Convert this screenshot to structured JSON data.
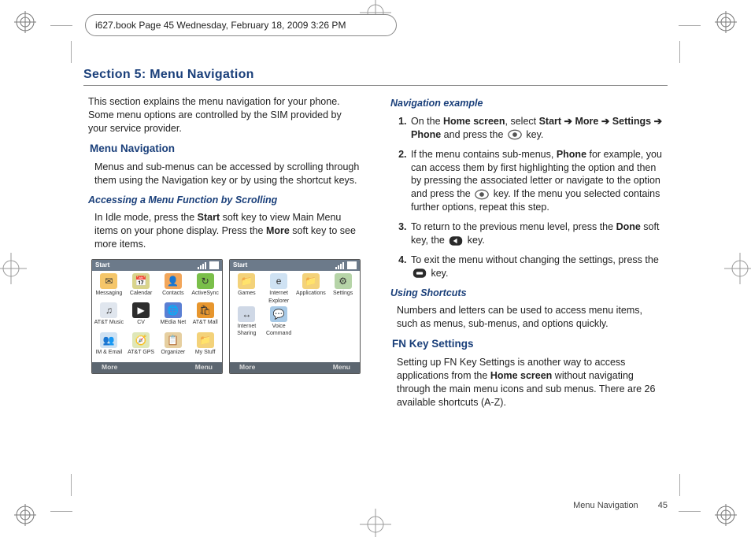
{
  "header_text": "i627.book  Page 45  Wednesday, February 18, 2009  3:26 PM",
  "section_title": "Section 5: Menu Navigation",
  "leftcol": {
    "intro": "This section explains the menu navigation for your phone. Some menu options are controlled by the SIM provided by your service provider.",
    "h2_menu_nav": "Menu Navigation",
    "menu_nav_p": "Menus and sub-menus can be accessed by scrolling through them using the Navigation key or by using the shortcut keys.",
    "h3_accessing": "Accessing a Menu Function by Scrolling",
    "accessing_p_pre": "In Idle mode, press the ",
    "accessing_b_start": "Start",
    "accessing_p_mid": " soft key to view Main Menu items on your phone display. Press the ",
    "accessing_b_more": "More",
    "accessing_p_end": " soft key to see more items."
  },
  "rightcol": {
    "h3_navex": "Navigation example",
    "step1_pre": "On the ",
    "step1_b_home": "Home screen",
    "step1_mid": ", select ",
    "step1_b_start": "Start",
    "step1_a1": " ➔ ",
    "step1_b_more": "More",
    "step1_a2": " ➔ ",
    "step1_b_settings": "Settings",
    "step1_a3": " ➔ ",
    "step1_b_phone": "Phone",
    "step1_post": " and press the ",
    "step1_end": " key.",
    "step2_pre": "If the menu contains sub-menus, ",
    "step2_b_phone": "Phone",
    "step2_mid": " for example, you can access them by first highlighting the option and then by pressing the associated letter or navigate to the option and press the ",
    "step2_end": " key. If the menu you selected contains further options, repeat this step.",
    "step3_pre": "To return to the previous menu level, press the ",
    "step3_b_done": "Done",
    "step3_mid": " soft key, the ",
    "step3_end": " key.",
    "step4_pre": "To exit the menu without changing the settings, press the ",
    "step4_end": " key.",
    "h3_shortcuts": "Using Shortcuts",
    "shortcuts_p": "Numbers and letters can be used to access menu items, such as menus, sub-menus, and options quickly.",
    "h2_fn": "FN Key Settings",
    "fn_p_pre": "Setting up FN Key Settings is another way to access applications from the ",
    "fn_b_home": "Home screen",
    "fn_p_post": " without navigating through the main menu icons and sub menus. There are 26 available shortcuts (A-Z)."
  },
  "screens": {
    "topbar_label": "Start",
    "soft_left": "More",
    "soft_right": "Menu",
    "grid1": [
      {
        "label": "Messaging",
        "bg": "#f5c66a",
        "glyph": "✉"
      },
      {
        "label": "Calendar",
        "bg": "#d9d48c",
        "glyph": "📅"
      },
      {
        "label": "Contacts",
        "bg": "#f2a65a",
        "glyph": "👤"
      },
      {
        "label": "ActiveSync",
        "bg": "#7abf4a",
        "glyph": "↻"
      },
      {
        "label": "AT&T Music",
        "bg": "#e0e6ee",
        "glyph": "♫"
      },
      {
        "label": "CV",
        "bg": "#2d2d2d",
        "glyph": "▶",
        "fg": "#fff"
      },
      {
        "label": "MEdia Net",
        "bg": "#5a7fd3",
        "glyph": "🌐",
        "fg": "#fff"
      },
      {
        "label": "AT&T Mall",
        "bg": "#e7962e",
        "glyph": "🛍"
      },
      {
        "label": "IM & Email",
        "bg": "#cfe2f3",
        "glyph": "👥"
      },
      {
        "label": "AT&T GPS",
        "bg": "#dfe7b8",
        "glyph": "🧭"
      },
      {
        "label": "Organizer",
        "bg": "#e6cfa0",
        "glyph": "📋"
      },
      {
        "label": "My Stuff",
        "bg": "#f3d27a",
        "glyph": "📁"
      }
    ],
    "grid2": [
      {
        "label": "Games",
        "bg": "#f3d27a",
        "glyph": "📁"
      },
      {
        "label": "Internet Explorer",
        "bg": "#cfe2f3",
        "glyph": "e"
      },
      {
        "label": "Applications",
        "bg": "#f3d27a",
        "glyph": "📁"
      },
      {
        "label": "Settings",
        "bg": "#b6d4a8",
        "glyph": "⚙"
      },
      {
        "label": "Internet Sharing",
        "bg": "#cfd8e6",
        "glyph": "↔"
      },
      {
        "label": "Voice Command",
        "bg": "#a7c9e6",
        "glyph": "💬"
      }
    ]
  },
  "footer": {
    "label": "Menu Navigation",
    "page": "45"
  }
}
